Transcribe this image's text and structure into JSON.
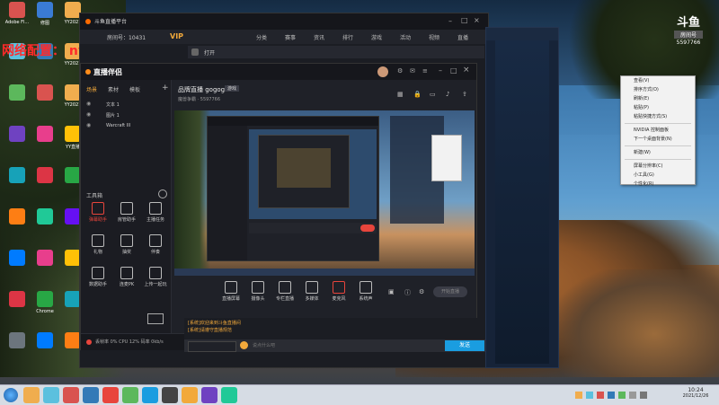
{
  "desktop": {
    "icons_left": [
      {
        "label": "Adobe Fl...",
        "color": "#d9534f"
      },
      {
        "label": "修图",
        "color": "#3a7bd5"
      },
      {
        "label": "YY2021",
        "color": "#f0ad4e"
      },
      {
        "label": "",
        "color": "#5bc0de"
      },
      {
        "label": "",
        "color": "#337ab7"
      },
      {
        "label": "YY2021",
        "color": "#f0ad4e"
      },
      {
        "label": "",
        "color": "#5cb85c"
      },
      {
        "label": "",
        "color": "#d9534f"
      },
      {
        "label": "YY2021",
        "color": "#f0ad4e"
      },
      {
        "label": "",
        "color": "#6f42c1"
      },
      {
        "label": "",
        "color": "#e83e8c"
      },
      {
        "label": "YY直播",
        "color": "#ffc107"
      },
      {
        "label": "",
        "color": "#17a2b8"
      },
      {
        "label": "",
        "color": "#dc3545"
      },
      {
        "label": "",
        "color": "#28a745"
      },
      {
        "label": "",
        "color": "#fd7e14"
      },
      {
        "label": "",
        "color": "#20c997"
      },
      {
        "label": "",
        "color": "#6610f2"
      },
      {
        "label": "",
        "color": "#007bff"
      },
      {
        "label": "",
        "color": "#e83e8c"
      },
      {
        "label": "",
        "color": "#ffc107"
      },
      {
        "label": "",
        "color": "#dc3545"
      },
      {
        "label": "Chrome",
        "color": "#28a745"
      },
      {
        "label": "",
        "color": "#17a2b8"
      },
      {
        "label": "",
        "color": "#6c757d"
      },
      {
        "label": "",
        "color": "#007bff"
      },
      {
        "label": "",
        "color": "#fd7e14"
      }
    ]
  },
  "overlay_red_text": "网络配置： nys666666",
  "outer_window": {
    "title": "斗鱼直播平台",
    "room_label": "房间号：10431",
    "vip": "VIP",
    "nav": [
      "分类",
      "赛事",
      "资讯",
      "排行",
      "游戏",
      "活动",
      "视频",
      "直播"
    ],
    "open_label": "打开"
  },
  "streamer_app": {
    "logo": "直播伴侣",
    "side_tabs": [
      "场景",
      "素材",
      "模板"
    ],
    "side_sources": [
      "文本 1",
      "图片 1",
      "Warcraft III"
    ],
    "tools_heading": "工具箱",
    "tools": [
      "弹幕助手",
      "房管助手",
      "主播任务",
      "礼物",
      "抽奖",
      "伴奏",
      "数据助手",
      "连麦PK",
      "上传一起玩"
    ],
    "stream_title": "品牌直播 gogogo",
    "stream_tag": "游戏",
    "stream_sub": "魔兽争霸  ·  5597766",
    "bottom_buttons": [
      "直播屏幕",
      "摄像头",
      "专栏直播",
      "多媒体",
      "麦克风",
      "系统声"
    ],
    "start_label": "开始直播",
    "status_bar": "丢帧率 0%  CPU 12%  码率 0kb/s"
  },
  "chat": {
    "lines": [
      "[系统]欢迎来到斗鱼直播间",
      "[系统]请遵守直播规范"
    ],
    "input_placeholder": "说点什么吧",
    "send_label": "发送"
  },
  "douyu_badge": {
    "brand": "斗鱼",
    "sub": "房间号",
    "id": "5597766"
  },
  "context_menu": {
    "items": [
      "查看(V)",
      "排序方式(O)",
      "刷新(E)",
      "粘贴(P)",
      "粘贴快捷方式(S)",
      "NVIDIA 控制面板",
      "下一个桌面背景(N)",
      "新建(W)",
      "屏幕分辨率(C)",
      "小工具(G)",
      "个性化(R)"
    ]
  },
  "taskbar": {
    "time": "10:24",
    "date": "2021/12/26"
  }
}
